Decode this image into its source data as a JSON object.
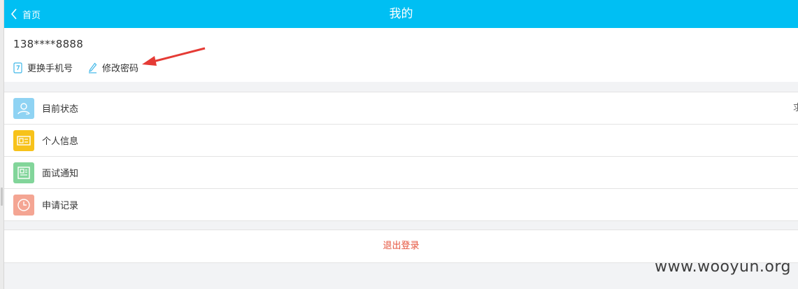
{
  "header": {
    "back_label": "首页",
    "title": "我的",
    "background": "#00bff3"
  },
  "profile": {
    "phone": "138****8888",
    "actions": [
      {
        "label": "更换手机号",
        "icon": "phone-icon"
      },
      {
        "label": "修改密码",
        "icon": "pencil-icon"
      }
    ]
  },
  "menu": {
    "items": [
      {
        "label": "目前状态",
        "icon": "user-status-icon",
        "icon_color": "#8fd3f3",
        "value": "求"
      },
      {
        "label": "个人信息",
        "icon": "id-card-icon",
        "icon_color": "#f7c21a",
        "value": ""
      },
      {
        "label": "面试通知",
        "icon": "newspaper-icon",
        "icon_color": "#82d59a",
        "value": ""
      },
      {
        "label": "申请记录",
        "icon": "clock-icon",
        "icon_color": "#f4a593",
        "value": ""
      }
    ]
  },
  "logout": {
    "label": "退出登录",
    "color": "#e5533c"
  },
  "watermark": "www.wooyun.org"
}
